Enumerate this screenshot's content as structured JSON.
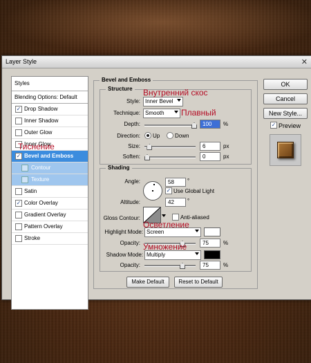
{
  "window": {
    "title": "Layer Style",
    "close_glyph": "✕"
  },
  "left_panel": {
    "header": "Styles",
    "blending_options": "Blending Options: Default",
    "items": [
      {
        "label": "Drop Shadow",
        "checked": true
      },
      {
        "label": "Inner Shadow",
        "checked": false
      },
      {
        "label": "Outer Glow",
        "checked": false
      },
      {
        "label": "Inner Glow",
        "checked": false
      },
      {
        "label": "Bevel and Emboss",
        "checked": true
      },
      {
        "label": "Contour",
        "checked": false
      },
      {
        "label": "Texture",
        "checked": false
      },
      {
        "label": "Satin",
        "checked": false
      },
      {
        "label": "Color Overlay",
        "checked": true
      },
      {
        "label": "Gradient Overlay",
        "checked": false
      },
      {
        "label": "Pattern Overlay",
        "checked": false
      },
      {
        "label": "Stroke",
        "checked": false
      }
    ]
  },
  "bevel": {
    "title": "Bevel and Emboss",
    "structure": {
      "legend": "Structure",
      "style_label": "Style:",
      "style_value": "Inner Bevel",
      "technique_label": "Technique:",
      "technique_value": "Smooth",
      "depth_label": "Depth:",
      "depth_value": "100",
      "depth_unit": "%",
      "depth_level": 1.0,
      "direction_label": "Direction:",
      "dir_up": "Up",
      "dir_down": "Down",
      "size_label": "Size:",
      "size_value": "6",
      "size_unit": "px",
      "size_level": 0.05,
      "soften_label": "Soften:",
      "soften_value": "0",
      "soften_unit": "px",
      "soften_level": 0.0
    },
    "shading": {
      "legend": "Shading",
      "angle_label": "Angle:",
      "angle_value": "58",
      "global_light": "Use Global Light",
      "altitude_label": "Altitude:",
      "altitude_value": "42",
      "gloss_label": "Gloss Contour:",
      "anti_aliased": "Anti-aliased",
      "highlight_label": "Highlight Mode:",
      "highlight_value": "Screen",
      "highlight_color": "#ffffff",
      "opacity_label": "Opacity:",
      "highlight_opacity": "75",
      "highlight_opacity_level": 0.75,
      "shadow_label": "Shadow Mode:",
      "shadow_value": "Multiply",
      "shadow_color": "#000000",
      "shadow_opacity": "75",
      "shadow_opacity_level": 0.75,
      "unit": "%",
      "degree": "°"
    },
    "make_default": "Make Default",
    "reset_default": "Reset to Default"
  },
  "right_buttons": {
    "ok": "OK",
    "cancel": "Cancel",
    "new_style": "New Style...",
    "preview": "Preview"
  },
  "annotations": {
    "inner_bevel": "Внутренний скос",
    "smooth": "Плавный",
    "emboss": "Тиснение",
    "screen": "Осветление",
    "multiply": "Умножение"
  }
}
